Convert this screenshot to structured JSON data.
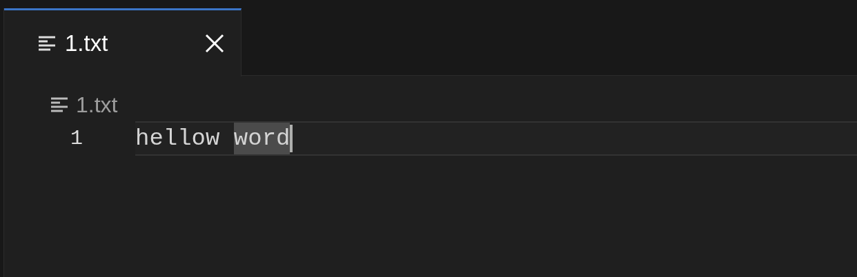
{
  "tabs": [
    {
      "label": "1.txt",
      "selected": true
    }
  ],
  "breadcrumb": [
    "1.txt"
  ],
  "editor": {
    "lines": [
      {
        "number": "1",
        "current": true,
        "cursor": true,
        "segments": [
          {
            "text": "hellow ",
            "selected": false
          },
          {
            "text": "word",
            "selected": true
          }
        ]
      }
    ]
  }
}
